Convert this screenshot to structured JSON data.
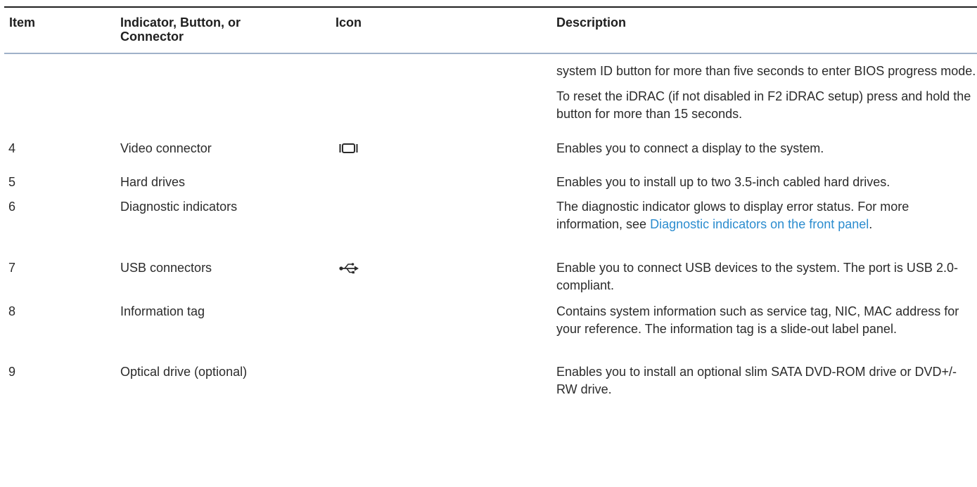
{
  "table": {
    "headers": {
      "item": "Item",
      "indicator": "Indicator, Button, or Connector",
      "icon": "Icon",
      "description": "Description"
    },
    "continued_description": [
      "system ID button for more than five seconds to enter BIOS progress mode.",
      "To reset the iDRAC (if not disabled in F2 iDRAC setup) press and hold the button for more than 15 seconds."
    ],
    "rows": [
      {
        "item": "4",
        "indicator": "Video connector",
        "icon": "video-connector-icon",
        "description": "Enables you to connect a display to the system."
      },
      {
        "item": "5",
        "indicator": "Hard drives",
        "icon": "",
        "description": "Enables you to install up to two 3.5-inch cabled hard drives."
      },
      {
        "item": "6",
        "indicator": "Diagnostic indicators",
        "icon": "",
        "description_before_link": "The diagnostic indicator glows to display error status. For more information, see ",
        "description_link": "Diagnostic indicators on the front panel",
        "description_after_link": "."
      },
      {
        "item": "7",
        "indicator": "USB connectors",
        "icon": "usb-icon",
        "description": "Enable you to connect USB devices to the system. The port is USB 2.0-compliant."
      },
      {
        "item": "8",
        "indicator": "Information tag",
        "icon": "",
        "description": "Contains system information such as service tag, NIC, MAC address for your reference. The information tag is a slide-out label panel."
      },
      {
        "item": "9",
        "indicator": "Optical drive (optional)",
        "icon": "",
        "description": "Enables you to install an optional slim SATA DVD-ROM drive or DVD+/-RW drive."
      }
    ]
  },
  "colors": {
    "text": "#2b2b2b",
    "link": "#2b8ccf",
    "header_rule": "#1f1f1f",
    "header_bottom_rule": "#9fb1c9"
  }
}
